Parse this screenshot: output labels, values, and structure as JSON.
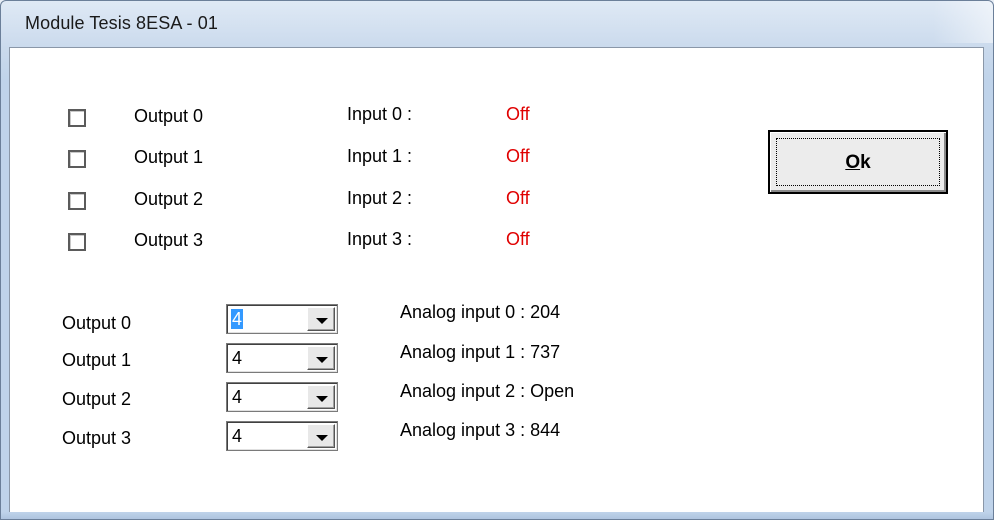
{
  "window": {
    "title": "Module Tesis 8ESA - 01"
  },
  "digital": [
    {
      "output_label": "Output 0",
      "checked": false,
      "input_label": "Input 0 :",
      "input_state": "Off"
    },
    {
      "output_label": "Output 1",
      "checked": false,
      "input_label": "Input 1 :",
      "input_state": "Off"
    },
    {
      "output_label": "Output 2",
      "checked": false,
      "input_label": "Input 2 :",
      "input_state": "Off"
    },
    {
      "output_label": "Output 3",
      "checked": false,
      "input_label": "Input 3 :",
      "input_state": "Off"
    }
  ],
  "analog": [
    {
      "output_label": "Output 0",
      "combo_value": "4",
      "input_text": "Analog input 0 : 204"
    },
    {
      "output_label": "Output 1",
      "combo_value": "4",
      "input_text": "Analog input 1 : 737"
    },
    {
      "output_label": "Output 2",
      "combo_value": "4",
      "input_text": "Analog input 2 : Open"
    },
    {
      "output_label": "Output 3",
      "combo_value": "4",
      "input_text": "Analog input 3 : 844"
    }
  ],
  "ok_button": {
    "mnemonic": "O",
    "rest": "k"
  },
  "colors": {
    "input_off": "#e00000",
    "selection": "#3399ff"
  },
  "icons": {
    "dropdown": "chevron-down-icon"
  }
}
